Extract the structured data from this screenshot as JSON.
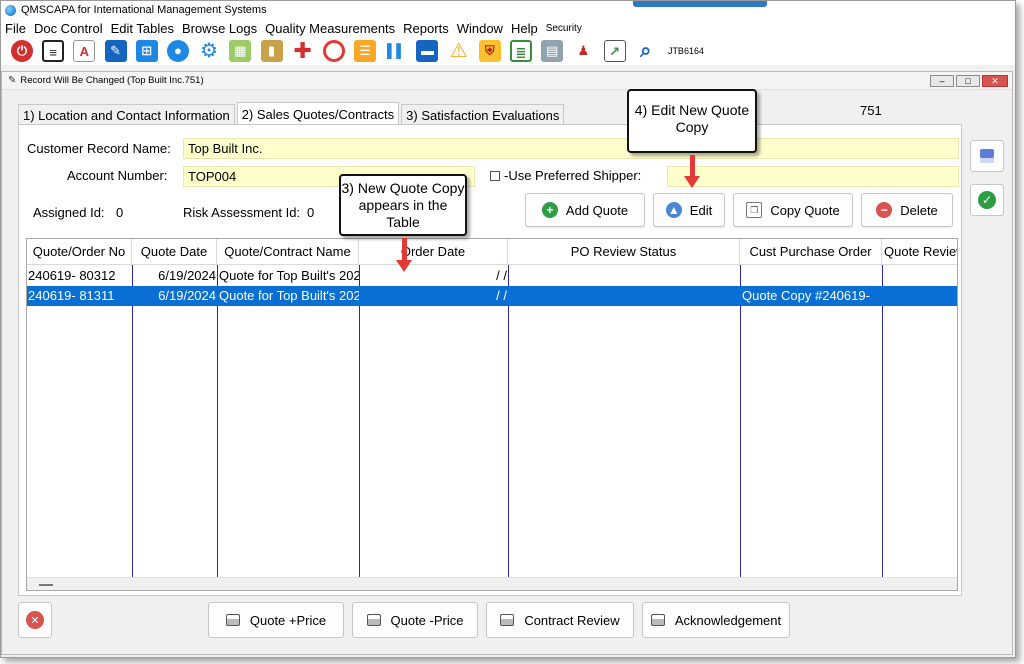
{
  "app": {
    "title": "QMSCAPA for International Management Systems",
    "menu": [
      "File",
      "Doc Control",
      "Edit Tables",
      "Browse Logs",
      "Quality Measurements",
      "Reports",
      "Window",
      "Help"
    ],
    "menu_security": "Security",
    "user_code": "JTB6164",
    "toolbar_icons": [
      "power-icon",
      "document-list-icon",
      "pdf-icon",
      "ruler-icon",
      "org-chart-icon",
      "chat-icon",
      "settings-gear-icon",
      "calendar-icon",
      "audit-book-icon",
      "first-aid-icon",
      "lifebuoy-icon",
      "notebook-icon",
      "bar-chart-icon",
      "scanner-icon",
      "warning-icon",
      "shield-icon",
      "checklist-icon",
      "server-icon",
      "staff-icon",
      "chart-trend-icon",
      "search-globe-icon"
    ]
  },
  "window": {
    "title": "Record Will Be Changed  (Top Built Inc.751)"
  },
  "tabs": [
    {
      "label": "1) Location and Contact Information",
      "active": false
    },
    {
      "label": "2) Sales Quotes/Contracts",
      "active": true
    },
    {
      "label": "3) Satisfaction Evaluations",
      "active": false
    }
  ],
  "record_number": "751",
  "form": {
    "customer_record_name_label": "Customer Record Name:",
    "customer_record_name": "Top Built Inc.",
    "account_number_label": "Account Number:",
    "account_number": "TOP004",
    "use_preferred_shipper_label": "-Use Preferred Shipper:",
    "preferred_shipper_value": "",
    "assigned_id_label": "Assigned Id:",
    "assigned_id": "0",
    "risk_assessment_id_label": "Risk Assessment Id:",
    "risk_assessment_id": "0"
  },
  "actions": {
    "add_quote": "Add Quote",
    "edit": "Edit",
    "copy_quote": "Copy Quote",
    "delete": "Delete"
  },
  "grid": {
    "columns": [
      "Quote/Order No",
      "Quote Date",
      "Quote/Contract Name",
      "Order Date",
      "PO Review Status",
      "Cust Purchase Order",
      "Quote Review"
    ],
    "rows": [
      {
        "quote_no": "240619- 80312",
        "quote_date": "6/19/2024",
        "name": "Quote for Top Built's 202",
        "order_date": "/ /",
        "po_status": "",
        "cust_po": "",
        "review": "",
        "selected": false
      },
      {
        "quote_no": "240619- 81311",
        "quote_date": "6/19/2024",
        "name": "Quote for Top Built's 202",
        "order_date": "/ /",
        "po_status": "",
        "cust_po": "Quote Copy #240619-",
        "review": "",
        "selected": true
      }
    ]
  },
  "bottom": {
    "quote_plus_price": "Quote +Price",
    "quote_minus_price": "Quote -Price",
    "contract_review": "Contract Review",
    "acknowledgement": "Acknowledgement"
  },
  "annotations": {
    "callout_3": "3) New Quote Copy appears in the Table",
    "callout_4": "4) Edit New Quote Copy"
  },
  "colors": {
    "selection": "#0a6fd4",
    "highlight_field": "#ffffcc",
    "grid_lines": "#2a2aa8",
    "arrow": "#e53935"
  }
}
